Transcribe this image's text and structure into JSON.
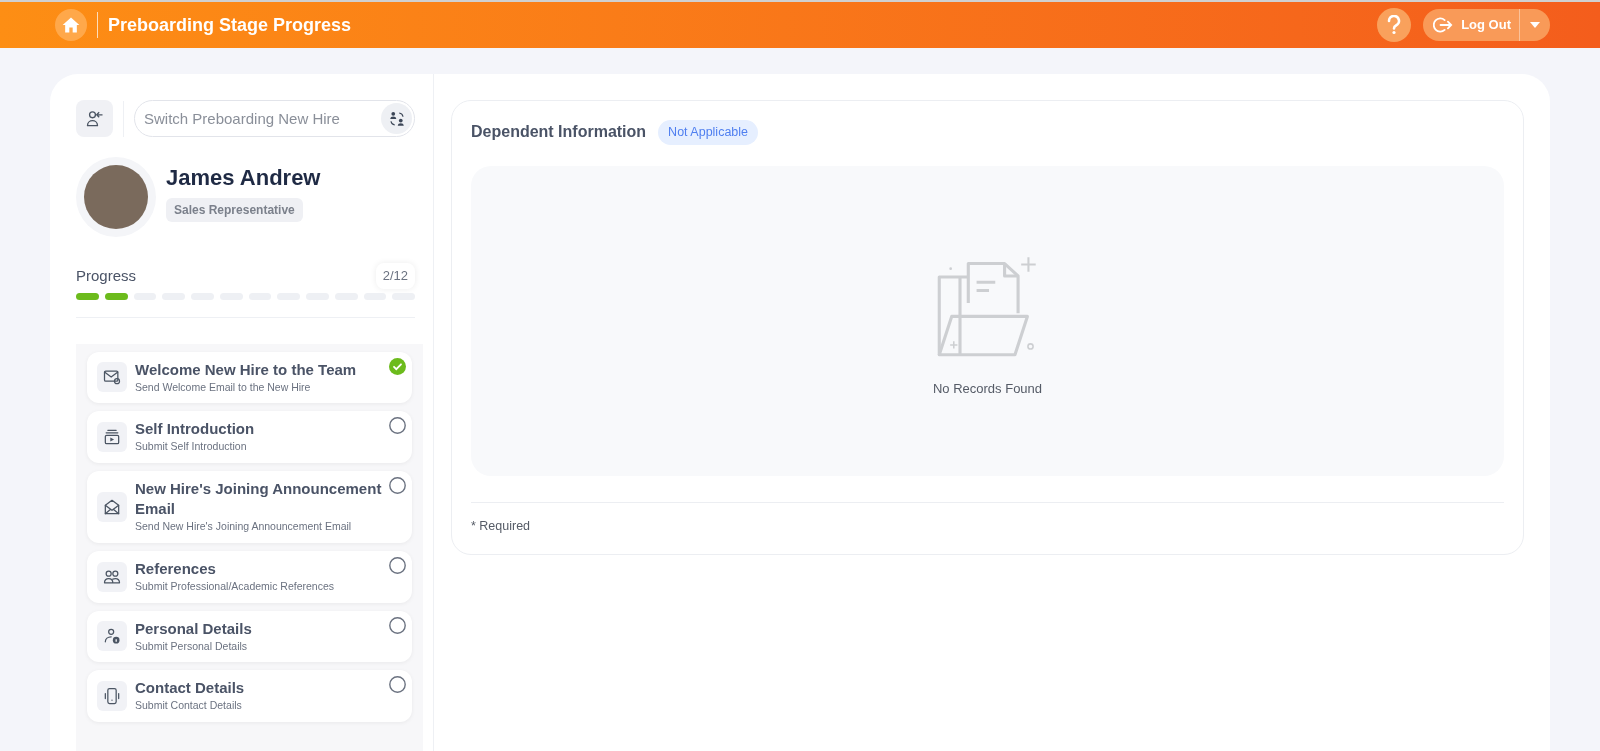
{
  "header": {
    "title": "Preboarding Stage Progress",
    "logout_label": "Log Out"
  },
  "switcher": {
    "placeholder": "Switch Preboarding New Hire"
  },
  "profile": {
    "name": "James Andrew",
    "role": "Sales Representative"
  },
  "progress": {
    "label": "Progress",
    "count": "2/12",
    "steps": [
      {
        "done": true
      },
      {
        "done": true
      },
      {
        "done": false
      },
      {
        "done": false
      },
      {
        "done": false
      },
      {
        "done": false
      },
      {
        "done": false
      },
      {
        "done": false
      },
      {
        "done": false
      },
      {
        "done": false
      },
      {
        "done": false
      },
      {
        "done": false
      }
    ]
  },
  "tasks": [
    {
      "kind": "mail-at",
      "title": "Welcome New Hire to the Team",
      "subtitle": "Send Welcome Email to the New Hire",
      "checked": true
    },
    {
      "kind": "video",
      "title": "Self Introduction",
      "subtitle": "Submit Self Introduction",
      "checked": false
    },
    {
      "kind": "envelope",
      "title": "New Hire's Joining Announcement Email",
      "subtitle": "Send New Hire's Joining Announcement Email",
      "checked": false
    },
    {
      "kind": "people",
      "title": "References",
      "subtitle": "Submit Professional/Academic References",
      "checked": false
    },
    {
      "kind": "person-info",
      "title": "Personal Details",
      "subtitle": "Submit Personal Details",
      "checked": false
    },
    {
      "kind": "phone",
      "title": "Contact Details",
      "subtitle": "Submit Contact Details",
      "checked": false
    }
  ],
  "section": {
    "title": "Dependent Information",
    "badge": "Not Applicable",
    "empty_message": "No Records Found",
    "footnote": "* Required"
  }
}
